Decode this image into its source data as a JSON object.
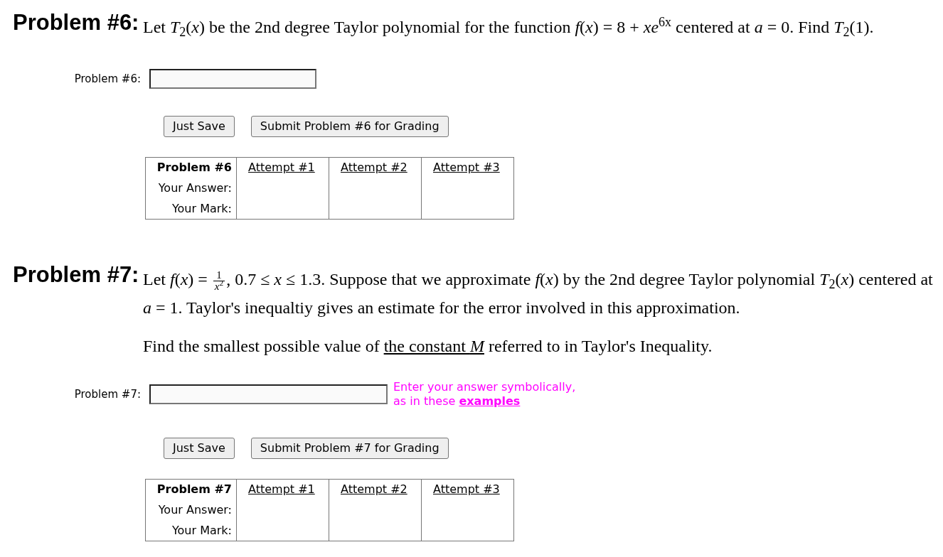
{
  "problems": [
    {
      "heading": "Problem #6:",
      "statement": [
        [
          {
            "kind": "text",
            "text": "Let *T*$_{2}$(*x*) be the 2nd degree Taylor polynomial for the function *f*(*x*) = 8 + *xe*$^{6x}$ centered at *a* = 0. Find *T*$_{2}$(1)."
          }
        ]
      ],
      "answer": {
        "label": "Problem #6:"
      },
      "buttons": [
        "Just Save",
        "Submit Problem #6 for Grading"
      ],
      "results": {
        "title": "Problem #6",
        "attempts": [
          "Attempt #1",
          "Attempt #2",
          "Attempt #3"
        ],
        "rows": [
          "Your Answer:",
          "Your Mark:"
        ]
      }
    },
    {
      "heading": "Problem #7:",
      "statement": [
        [
          {
            "kind": "text",
            "text": "Let *f*(*x*) = "
          },
          {
            "kind": "fraction",
            "numerator": "1",
            "denominator": "*x*$^{2}$"
          },
          {
            "kind": "text",
            "text": ", 0.7 ≤ *x* ≤ 1.3. Suppose that we approximate *f*(*x*) by the 2nd degree Taylor polynomial *T*$_{2}$(*x*) centered at *a* = 1. Taylor's inequaltiy gives an estimate for the error involved in this approximation."
          }
        ],
        [
          {
            "kind": "text",
            "text": "Find the smallest possible value of "
          },
          {
            "kind": "link",
            "text": "the constant *M*"
          },
          {
            "kind": "text",
            "text": " referred to in Taylor's Inequality."
          }
        ]
      ],
      "answer": {
        "label": "Problem #7:",
        "hint": "Enter your answer symbolically, as in these",
        "hint_link": "examples"
      },
      "buttons": [
        "Just Save",
        "Submit Problem #7 for Grading"
      ],
      "results": {
        "title": "Problem #7",
        "attempts": [
          "Attempt #1",
          "Attempt #2",
          "Attempt #3"
        ],
        "rows": [
          "Your Answer:",
          "Your Mark:"
        ]
      }
    }
  ]
}
